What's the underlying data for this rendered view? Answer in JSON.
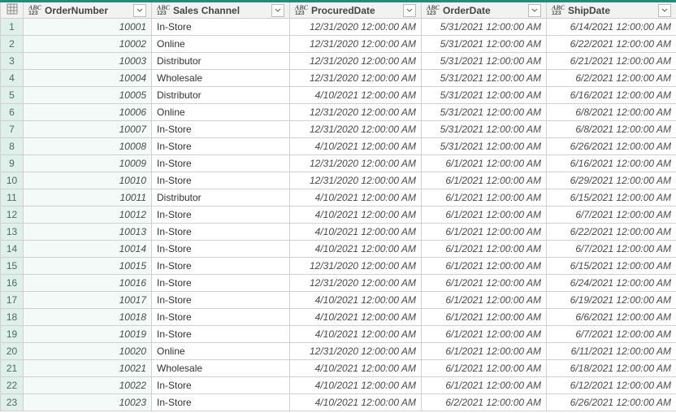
{
  "columns": [
    {
      "name": "OrderNumber",
      "type": "ABC123"
    },
    {
      "name": "Sales Channel",
      "type": "ABC123"
    },
    {
      "name": "ProcuredDate",
      "type": "ABC123"
    },
    {
      "name": "OrderDate",
      "type": "ABC123"
    },
    {
      "name": "ShipDate",
      "type": "ABC123"
    }
  ],
  "rows": [
    {
      "n": 1,
      "OrderNumber": "10001",
      "SalesChannel": "In-Store",
      "ProcuredDate": "12/31/2020 12:00:00 AM",
      "OrderDate": "5/31/2021 12:00:00 AM",
      "ShipDate": "6/14/2021 12:00:00 AM"
    },
    {
      "n": 2,
      "OrderNumber": "10002",
      "SalesChannel": "Online",
      "ProcuredDate": "12/31/2020 12:00:00 AM",
      "OrderDate": "5/31/2021 12:00:00 AM",
      "ShipDate": "6/22/2021 12:00:00 AM"
    },
    {
      "n": 3,
      "OrderNumber": "10003",
      "SalesChannel": "Distributor",
      "ProcuredDate": "12/31/2020 12:00:00 AM",
      "OrderDate": "5/31/2021 12:00:00 AM",
      "ShipDate": "6/21/2021 12:00:00 AM"
    },
    {
      "n": 4,
      "OrderNumber": "10004",
      "SalesChannel": "Wholesale",
      "ProcuredDate": "12/31/2020 12:00:00 AM",
      "OrderDate": "5/31/2021 12:00:00 AM",
      "ShipDate": "6/2/2021 12:00:00 AM"
    },
    {
      "n": 5,
      "OrderNumber": "10005",
      "SalesChannel": "Distributor",
      "ProcuredDate": "4/10/2021 12:00:00 AM",
      "OrderDate": "5/31/2021 12:00:00 AM",
      "ShipDate": "6/16/2021 12:00:00 AM"
    },
    {
      "n": 6,
      "OrderNumber": "10006",
      "SalesChannel": "Online",
      "ProcuredDate": "12/31/2020 12:00:00 AM",
      "OrderDate": "5/31/2021 12:00:00 AM",
      "ShipDate": "6/8/2021 12:00:00 AM"
    },
    {
      "n": 7,
      "OrderNumber": "10007",
      "SalesChannel": "In-Store",
      "ProcuredDate": "12/31/2020 12:00:00 AM",
      "OrderDate": "5/31/2021 12:00:00 AM",
      "ShipDate": "6/8/2021 12:00:00 AM"
    },
    {
      "n": 8,
      "OrderNumber": "10008",
      "SalesChannel": "In-Store",
      "ProcuredDate": "4/10/2021 12:00:00 AM",
      "OrderDate": "5/31/2021 12:00:00 AM",
      "ShipDate": "6/26/2021 12:00:00 AM"
    },
    {
      "n": 9,
      "OrderNumber": "10009",
      "SalesChannel": "In-Store",
      "ProcuredDate": "12/31/2020 12:00:00 AM",
      "OrderDate": "6/1/2021 12:00:00 AM",
      "ShipDate": "6/16/2021 12:00:00 AM"
    },
    {
      "n": 10,
      "OrderNumber": "10010",
      "SalesChannel": "In-Store",
      "ProcuredDate": "12/31/2020 12:00:00 AM",
      "OrderDate": "6/1/2021 12:00:00 AM",
      "ShipDate": "6/29/2021 12:00:00 AM"
    },
    {
      "n": 11,
      "OrderNumber": "10011",
      "SalesChannel": "Distributor",
      "ProcuredDate": "4/10/2021 12:00:00 AM",
      "OrderDate": "6/1/2021 12:00:00 AM",
      "ShipDate": "6/15/2021 12:00:00 AM"
    },
    {
      "n": 12,
      "OrderNumber": "10012",
      "SalesChannel": "In-Store",
      "ProcuredDate": "4/10/2021 12:00:00 AM",
      "OrderDate": "6/1/2021 12:00:00 AM",
      "ShipDate": "6/7/2021 12:00:00 AM"
    },
    {
      "n": 13,
      "OrderNumber": "10013",
      "SalesChannel": "In-Store",
      "ProcuredDate": "4/10/2021 12:00:00 AM",
      "OrderDate": "6/1/2021 12:00:00 AM",
      "ShipDate": "6/22/2021 12:00:00 AM"
    },
    {
      "n": 14,
      "OrderNumber": "10014",
      "SalesChannel": "In-Store",
      "ProcuredDate": "4/10/2021 12:00:00 AM",
      "OrderDate": "6/1/2021 12:00:00 AM",
      "ShipDate": "6/7/2021 12:00:00 AM"
    },
    {
      "n": 15,
      "OrderNumber": "10015",
      "SalesChannel": "In-Store",
      "ProcuredDate": "12/31/2020 12:00:00 AM",
      "OrderDate": "6/1/2021 12:00:00 AM",
      "ShipDate": "6/15/2021 12:00:00 AM"
    },
    {
      "n": 16,
      "OrderNumber": "10016",
      "SalesChannel": "In-Store",
      "ProcuredDate": "12/31/2020 12:00:00 AM",
      "OrderDate": "6/1/2021 12:00:00 AM",
      "ShipDate": "6/24/2021 12:00:00 AM"
    },
    {
      "n": 17,
      "OrderNumber": "10017",
      "SalesChannel": "In-Store",
      "ProcuredDate": "4/10/2021 12:00:00 AM",
      "OrderDate": "6/1/2021 12:00:00 AM",
      "ShipDate": "6/19/2021 12:00:00 AM"
    },
    {
      "n": 18,
      "OrderNumber": "10018",
      "SalesChannel": "In-Store",
      "ProcuredDate": "4/10/2021 12:00:00 AM",
      "OrderDate": "6/1/2021 12:00:00 AM",
      "ShipDate": "6/6/2021 12:00:00 AM"
    },
    {
      "n": 19,
      "OrderNumber": "10019",
      "SalesChannel": "In-Store",
      "ProcuredDate": "4/10/2021 12:00:00 AM",
      "OrderDate": "6/1/2021 12:00:00 AM",
      "ShipDate": "6/7/2021 12:00:00 AM"
    },
    {
      "n": 20,
      "OrderNumber": "10020",
      "SalesChannel": "Online",
      "ProcuredDate": "12/31/2020 12:00:00 AM",
      "OrderDate": "6/1/2021 12:00:00 AM",
      "ShipDate": "6/11/2021 12:00:00 AM"
    },
    {
      "n": 21,
      "OrderNumber": "10021",
      "SalesChannel": "Wholesale",
      "ProcuredDate": "4/10/2021 12:00:00 AM",
      "OrderDate": "6/1/2021 12:00:00 AM",
      "ShipDate": "6/18/2021 12:00:00 AM"
    },
    {
      "n": 22,
      "OrderNumber": "10022",
      "SalesChannel": "In-Store",
      "ProcuredDate": "4/10/2021 12:00:00 AM",
      "OrderDate": "6/1/2021 12:00:00 AM",
      "ShipDate": "6/12/2021 12:00:00 AM"
    },
    {
      "n": 23,
      "OrderNumber": "10023",
      "SalesChannel": "In-Store",
      "ProcuredDate": "4/10/2021 12:00:00 AM",
      "OrderDate": "6/2/2021 12:00:00 AM",
      "ShipDate": "6/26/2021 12:00:00 AM"
    }
  ]
}
